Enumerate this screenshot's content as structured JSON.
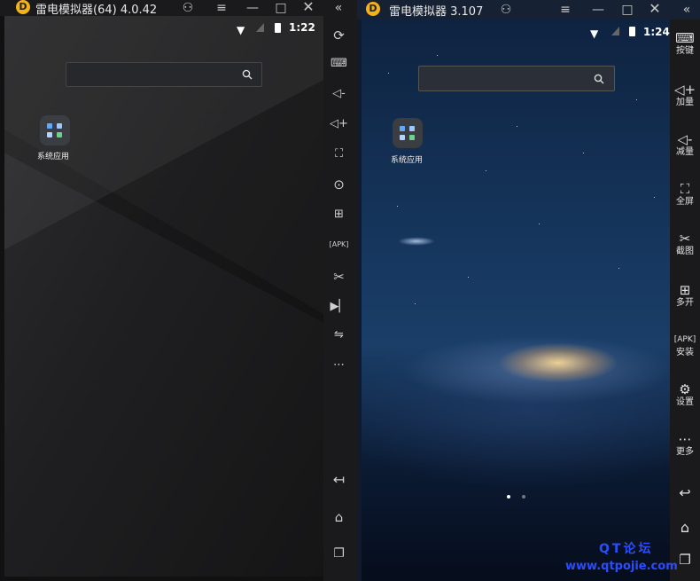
{
  "left_window": {
    "title": "雷电模拟器(64) 4.0.42",
    "logo": "D",
    "time": "1:22",
    "search_icon": "search-icon",
    "app_label": "系统应用",
    "toolbar_icons": [
      "sync-icon",
      "keyboard-icon",
      "volume-down-icon",
      "volume-up-icon",
      "fullscreen-icon",
      "record-icon",
      "multi-open-icon",
      "apk-install-icon",
      "screenshot-icon",
      "video-icon",
      "share-icon",
      "more-icon"
    ],
    "nav": [
      "back-icon",
      "home-icon",
      "recents-icon"
    ]
  },
  "right_window": {
    "title": "雷电模拟器 3.107",
    "logo": "D",
    "time": "1:24",
    "app_label": "系统应用",
    "toolbar": [
      {
        "icon": "keyboard-icon",
        "label": "按键"
      },
      {
        "icon": "volume-up-icon",
        "label": "加量"
      },
      {
        "icon": "volume-down-icon",
        "label": "减量"
      },
      {
        "icon": "fullscreen-icon",
        "label": "全屏"
      },
      {
        "icon": "screenshot-icon",
        "label": "截图"
      },
      {
        "icon": "multi-open-icon",
        "label": "多开"
      },
      {
        "icon": "apk-install-icon",
        "label": "安装"
      },
      {
        "icon": "settings-icon",
        "label": "设置"
      },
      {
        "icon": "more-icon",
        "label": "更多"
      }
    ],
    "nav": [
      "back-icon",
      "home-icon",
      "recents-icon"
    ],
    "page_indicator": {
      "count": 2,
      "active": 1
    }
  },
  "watermark": {
    "line1": "QT论坛",
    "line2": "www.qtpojie.com"
  },
  "colors": {
    "logo": "#f3b318",
    "watermark": "#2a4dff",
    "toolbar_bg": "#1a1a1c"
  }
}
